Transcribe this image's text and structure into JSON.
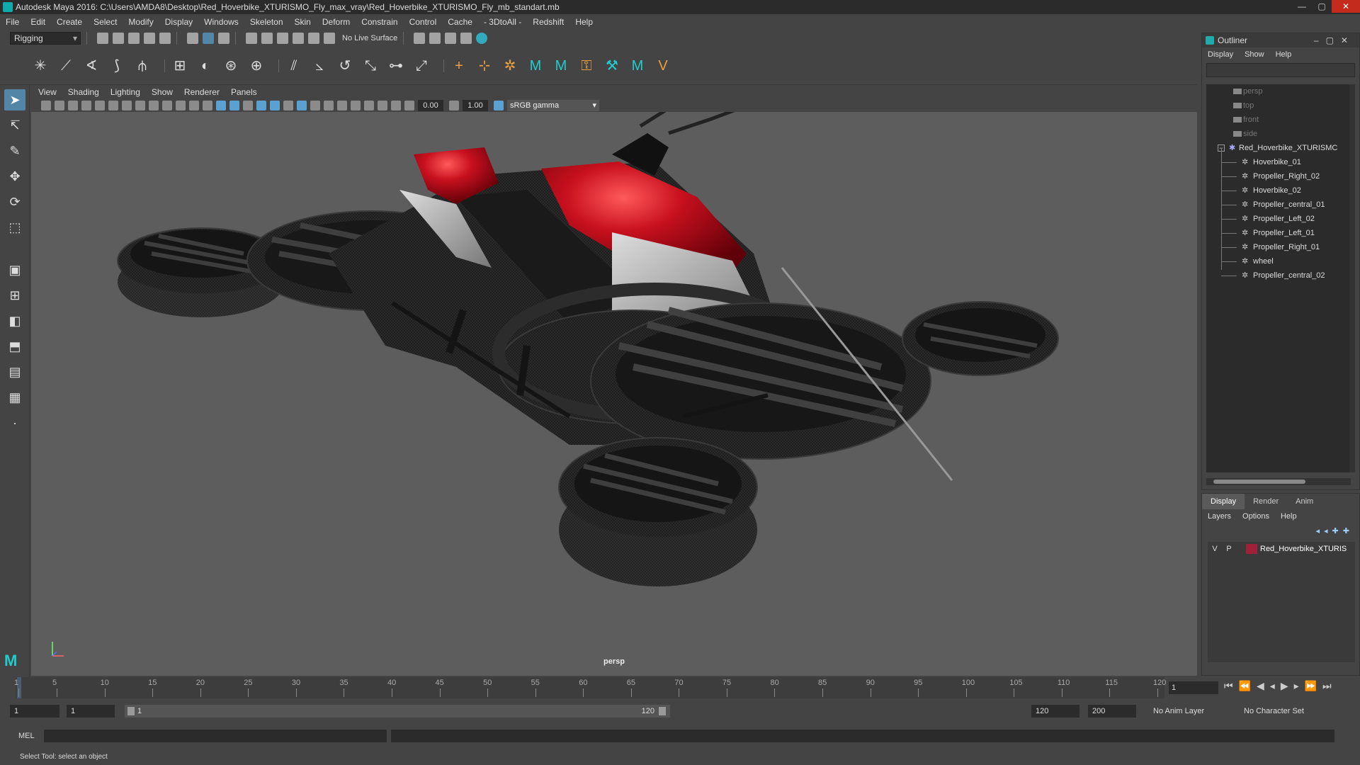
{
  "window": {
    "title": "Autodesk Maya 2016: C:\\Users\\AMDA8\\Desktop\\Red_Hoverbike_XTURISMO_Fly_max_vray\\Red_Hoverbike_XTURISMO_Fly_mb_standart.mb",
    "min": "—",
    "max": "▢",
    "close": "✕"
  },
  "menus": [
    "File",
    "Edit",
    "Create",
    "Select",
    "Modify",
    "Display",
    "Windows",
    "Skeleton",
    "Skin",
    "Deform",
    "Constrain",
    "Control",
    "Cache",
    "- 3DtoAll -",
    "Redshift",
    "Help"
  ],
  "status_toolbar": {
    "mode": "Rigging",
    "live_surface": "No Live Surface"
  },
  "viewport": {
    "menus": [
      "View",
      "Shading",
      "Lighting",
      "Show",
      "Renderer",
      "Panels"
    ],
    "exposure": "0.00",
    "gamma": "1.00",
    "color_space": "sRGB gamma",
    "camera_label": "persp"
  },
  "outliner": {
    "title": "Outliner",
    "menus": [
      "Display",
      "Show",
      "Help"
    ],
    "cameras": [
      "persp",
      "top",
      "front",
      "side"
    ],
    "root": "Red_Hoverbike_XTURISMC",
    "children": [
      "Hoverbike_01",
      "Propeller_Right_02",
      "Hoverbike_02",
      "Propeller_central_01",
      "Propeller_Left_02",
      "Propeller_Left_01",
      "Propeller_Right_01",
      "wheel",
      "Propeller_central_02"
    ]
  },
  "layer_editor": {
    "tabs": [
      "Display",
      "Render",
      "Anim"
    ],
    "menus": [
      "Layers",
      "Options",
      "Help"
    ],
    "layer": {
      "v": "V",
      "p": "P",
      "name": "Red_Hoverbike_XTURIS",
      "color": "#a0203a"
    }
  },
  "timeline": {
    "ticks": [
      1,
      5,
      10,
      15,
      20,
      25,
      30,
      35,
      40,
      45,
      50,
      55,
      60,
      65,
      70,
      75,
      80,
      85,
      90,
      95,
      100,
      105,
      110,
      115,
      120
    ],
    "current_frame": "1"
  },
  "range": {
    "start": "1",
    "playback_start": "1",
    "slider_start": "1",
    "slider_end": "120",
    "playback_end": "120",
    "end": "200",
    "anim_layer": "No Anim Layer",
    "character_set": "No Character Set"
  },
  "command_line": {
    "label": "MEL"
  },
  "status_line": {
    "text": "Select Tool: select an object"
  },
  "colors": {
    "accent": "#5285a6",
    "bike_red": "#c8101e",
    "viewport_bg": "#5d5d5d"
  }
}
